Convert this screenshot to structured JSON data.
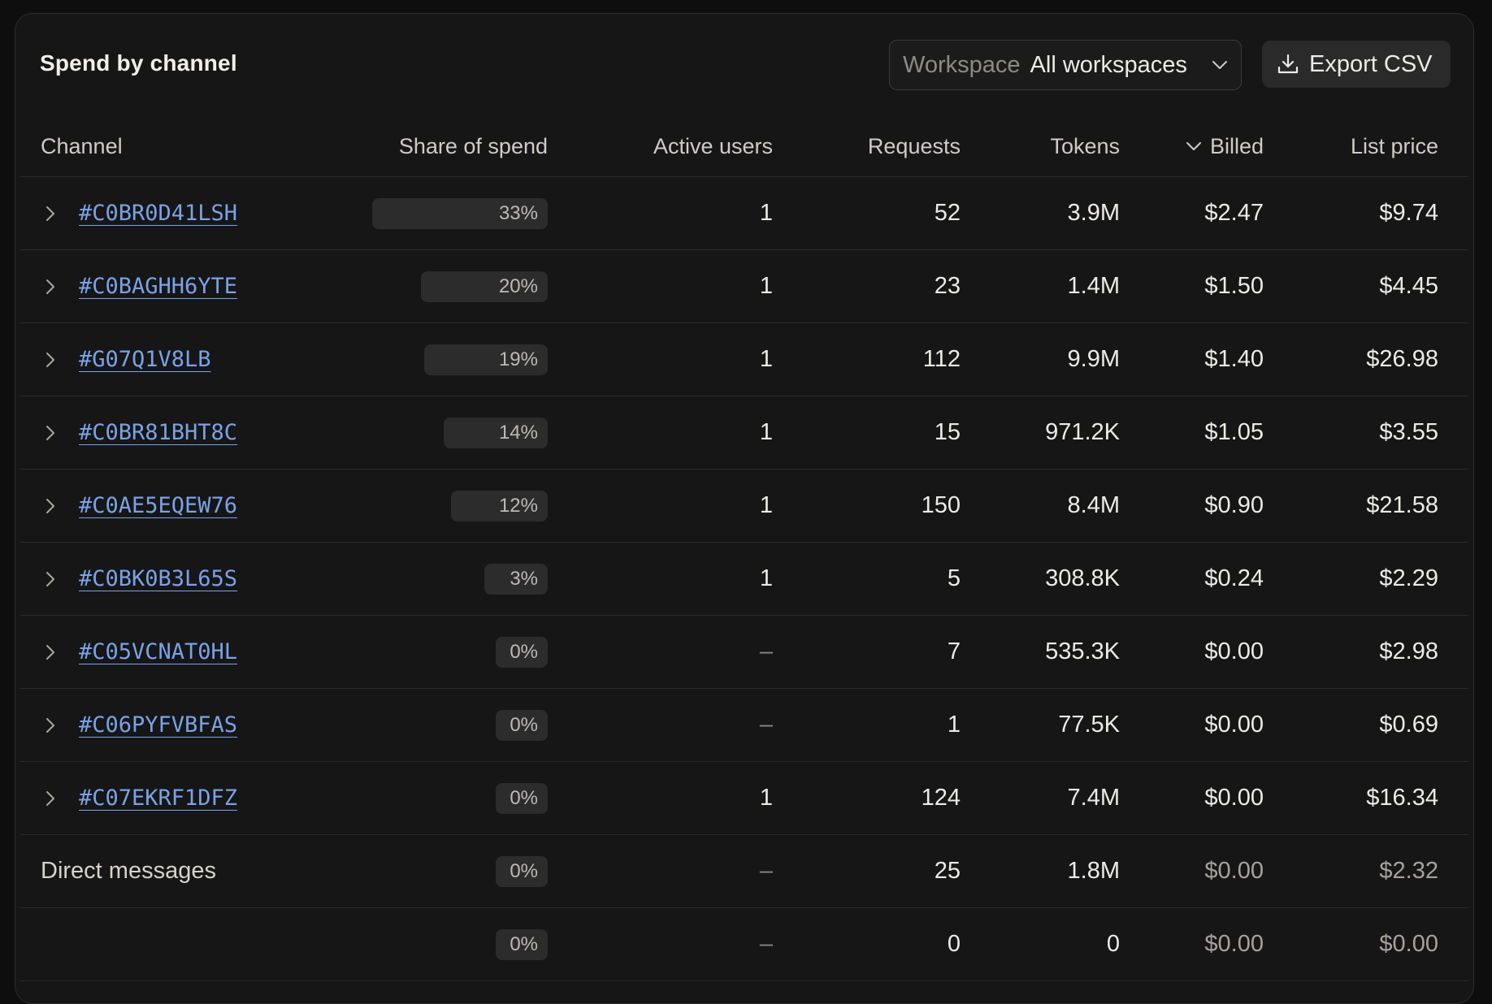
{
  "header": {
    "title": "Spend by channel",
    "workspace_label": "Workspace",
    "workspace_value": "All workspaces",
    "export_label": "Export CSV"
  },
  "columns": {
    "channel": "Channel",
    "share": "Share of spend",
    "users": "Active users",
    "requests": "Requests",
    "tokens": "Tokens",
    "billed": "Billed",
    "list_price": "List price"
  },
  "sort": {
    "column": "Billed",
    "direction": "descending"
  },
  "rows": [
    {
      "channel": "#C0BR0D41LSH",
      "link": true,
      "share": "33%",
      "share_fraction": 0.33,
      "users": "1",
      "requests": "52",
      "tokens": "3.9M",
      "billed": "$2.47",
      "list_price": "$9.74"
    },
    {
      "channel": "#C0BAGHH6YTE",
      "link": true,
      "share": "20%",
      "share_fraction": 0.2,
      "users": "1",
      "requests": "23",
      "tokens": "1.4M",
      "billed": "$1.50",
      "list_price": "$4.45"
    },
    {
      "channel": "#G07Q1V8LB",
      "link": true,
      "share": "19%",
      "share_fraction": 0.19,
      "users": "1",
      "requests": "112",
      "tokens": "9.9M",
      "billed": "$1.40",
      "list_price": "$26.98"
    },
    {
      "channel": "#C0BR81BHT8C",
      "link": true,
      "share": "14%",
      "share_fraction": 0.14,
      "users": "1",
      "requests": "15",
      "tokens": "971.2K",
      "billed": "$1.05",
      "list_price": "$3.55"
    },
    {
      "channel": "#C0AE5EQEW76",
      "link": true,
      "share": "12%",
      "share_fraction": 0.12,
      "users": "1",
      "requests": "150",
      "tokens": "8.4M",
      "billed": "$0.90",
      "list_price": "$21.58"
    },
    {
      "channel": "#C0BK0B3L65S",
      "link": true,
      "share": "3%",
      "share_fraction": 0.03,
      "users": "1",
      "requests": "5",
      "tokens": "308.8K",
      "billed": "$0.24",
      "list_price": "$2.29"
    },
    {
      "channel": "#C05VCNAT0HL",
      "link": true,
      "share": "0%",
      "share_fraction": 0.0,
      "users": "–",
      "requests": "7",
      "tokens": "535.3K",
      "billed": "$0.00",
      "list_price": "$2.98"
    },
    {
      "channel": "#C06PYFVBFAS",
      "link": true,
      "share": "0%",
      "share_fraction": 0.0,
      "users": "–",
      "requests": "1",
      "tokens": "77.5K",
      "billed": "$0.00",
      "list_price": "$0.69"
    },
    {
      "channel": "#C07EKRF1DFZ",
      "link": true,
      "share": "0%",
      "share_fraction": 0.0,
      "users": "1",
      "requests": "124",
      "tokens": "7.4M",
      "billed": "$0.00",
      "list_price": "$16.34"
    },
    {
      "channel": "Direct messages",
      "link": false,
      "share": "0%",
      "share_fraction": 0.0,
      "users": "–",
      "requests": "25",
      "tokens": "1.8M",
      "billed": "$0.00",
      "list_price": "$2.32"
    },
    {
      "channel": "",
      "link": false,
      "share": "0%",
      "share_fraction": 0.0,
      "users": "–",
      "requests": "0",
      "tokens": "0",
      "billed": "$0.00",
      "list_price": "$0.00"
    }
  ]
}
